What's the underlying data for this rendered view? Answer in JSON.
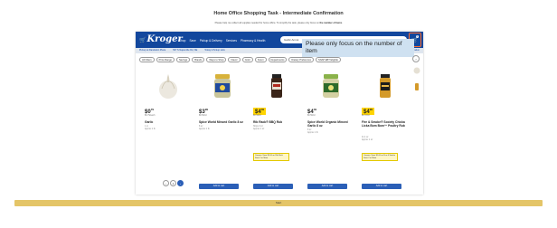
{
  "task": {
    "title": "Home Office Shopping Task - Intermediate Confirmation",
    "instruction_prefix": "Please help me collect all supplies needed for home office. To simplify the task, please only focus on",
    "instruction_bold": "the number of items"
  },
  "header": {
    "logo": "Kroger",
    "nav": [
      "Shop",
      "Save",
      "Pickup & Delivery",
      "Services",
      "Pharmacy & Health"
    ],
    "search_value": "Garlic Annot",
    "cart_count": "0"
  },
  "tooltip": {
    "text": "Please only focus on the number of item"
  },
  "subbar": {
    "left": "Pickup at Dandelion Plaza",
    "store": "567 S Naperville Rd, NE",
    "mid": "Today's Pickup slots",
    "right": "Weekly Ad",
    "far": "New Location"
  },
  "filters": [
    "All Filters",
    "Price Range",
    "Savings",
    "Brands",
    "Ways to Shop",
    "Flavor",
    "Color",
    "Scent",
    "Departments",
    "Dietary Preference",
    "SNAP EBT Eligible"
  ],
  "products": [
    {
      "price_main": "$0",
      "price_cents": "79",
      "sale": false,
      "unit": "$0.79/each",
      "name": "Garlic",
      "meta1": "1 ct",
      "meta2": "Approx 1 lb",
      "coupon": "",
      "add": "Add to cart"
    },
    {
      "price_main": "$3",
      "price_cents": "99",
      "sale": false,
      "unit": "$0.50/oz",
      "name": "Spice World Minced Garlic 8 oz",
      "meta1": "8 oz",
      "meta2": "Approx 1 lb",
      "coupon": "",
      "add": "Add to cart"
    },
    {
      "price_main": "$4",
      "price_cents": "49",
      "sale": true,
      "unit": "$0.34/oz",
      "name": "Rib Rack® BBQ Rub",
      "meta1": "Ships 3 oz",
      "meta2": "Approx 1 oz",
      "coupon": "Coupon: Save $1.00 on Rib Rack Save 2 or More",
      "add": "Add to cart"
    },
    {
      "price_main": "$4",
      "price_cents": "49",
      "sale": false,
      "unit": "$0.56/oz",
      "name": "Spice World Organic Minced Garlic 8 oz",
      "meta1": "8 oz",
      "meta2": "Approx 1 lb",
      "coupon": "",
      "add": "Add to cart"
    },
    {
      "price_main": "$4",
      "price_cents": "99",
      "sale": true,
      "unit": "$1.67/oz",
      "name": "Fire & Smoke® Society Chicka Licka Bom Bom™ Poultry Rub",
      "meta1": "11.4 oz",
      "meta2": "Approx 1 oz",
      "coupon": "Coupon: Save $1.00 on Fire & Smoke Save 2 or More",
      "add": "Add to cart"
    }
  ],
  "pager": [
    "‹",
    "1",
    "›"
  ],
  "start_label": "Start",
  "colors": {
    "kroger_blue": "#12479d",
    "sale_yellow": "#ffd400",
    "start_bar": "#e4c568",
    "add_button": "#2b5fb7"
  }
}
